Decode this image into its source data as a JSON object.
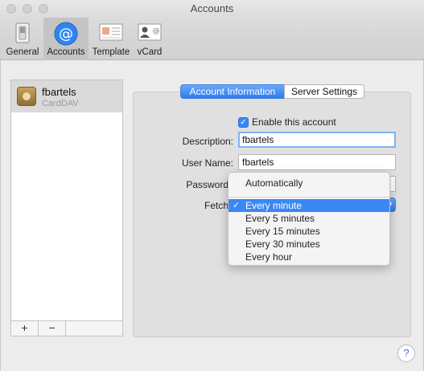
{
  "window": {
    "title": "Accounts"
  },
  "toolbar": {
    "items": [
      {
        "label": "General",
        "icon": "switch-icon"
      },
      {
        "label": "Accounts",
        "icon": "at-sign-icon"
      },
      {
        "label": "Template",
        "icon": "template-icon"
      },
      {
        "label": "vCard",
        "icon": "vcard-icon"
      }
    ],
    "selected": "Accounts"
  },
  "accounts": [
    {
      "name": "fbartels",
      "type": "CardDAV"
    }
  ],
  "list_controls": {
    "add_label": "+",
    "remove_label": "−"
  },
  "tabs": {
    "active": "Account Information",
    "inactive": "Server Settings"
  },
  "form": {
    "enable_label": "Enable this account",
    "enable_checked": true,
    "description_label": "Description:",
    "description_value": "fbartels",
    "username_label": "User Name:",
    "username_value": "fbartels",
    "password_label": "Password",
    "fetch_label": "Fetch"
  },
  "fetch_menu": {
    "items": [
      "Automatically",
      "Every minute",
      "Every 5 minutes",
      "Every 15 minutes",
      "Every 30 minutes",
      "Every hour"
    ],
    "selected": "Every minute",
    "check_glyph": "✓"
  },
  "help": {
    "label": "?"
  },
  "colors": {
    "accent": "#3b87f4",
    "selection": "#dadada"
  }
}
